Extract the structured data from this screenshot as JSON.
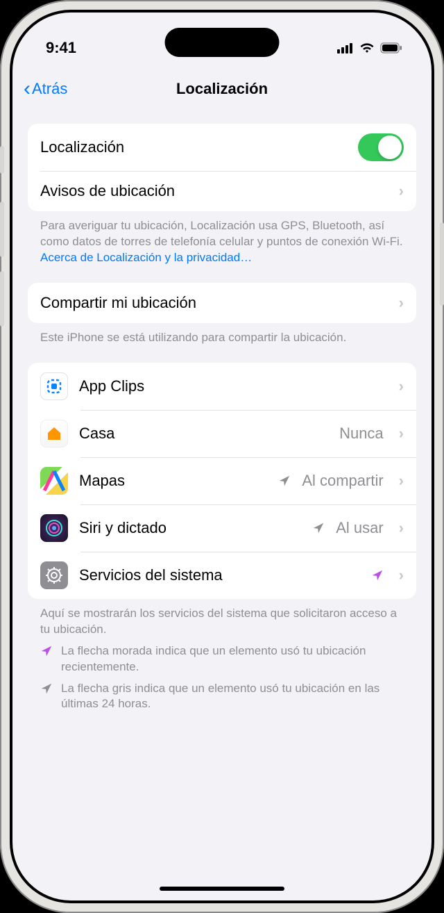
{
  "status": {
    "time": "9:41"
  },
  "nav": {
    "back": "Atrás",
    "title": "Localización"
  },
  "section1": {
    "location_label": "Localización",
    "alerts_label": "Avisos de ubicación"
  },
  "footer1": {
    "text": "Para averiguar tu ubicación, Localización usa GPS, Bluetooth, así como datos de torres de telefonía celular y puntos de conexión Wi-Fi. ",
    "link": "Acerca de Localización y la privacidad…"
  },
  "section2": {
    "share_label": "Compartir mi ubicación"
  },
  "footer2": {
    "text": "Este iPhone se está utilizando para compartir la ubicación."
  },
  "apps": [
    {
      "label": "App Clips",
      "value": "",
      "arrow": "none"
    },
    {
      "label": "Casa",
      "value": "Nunca",
      "arrow": "none"
    },
    {
      "label": "Mapas",
      "value": "Al compartir",
      "arrow": "gray"
    },
    {
      "label": "Siri y dictado",
      "value": "Al usar",
      "arrow": "gray"
    },
    {
      "label": "Servicios del sistema",
      "value": "",
      "arrow": "purple"
    }
  ],
  "footer3": {
    "text": "Aquí se mostrarán los servicios del sistema que solicitaron acceso a tu ubicación."
  },
  "legend": {
    "purple": "La flecha morada indica que un elemento usó tu ubicación recientemente.",
    "gray": "La flecha gris indica que un elemento usó tu ubicación en las últimas 24 horas."
  }
}
